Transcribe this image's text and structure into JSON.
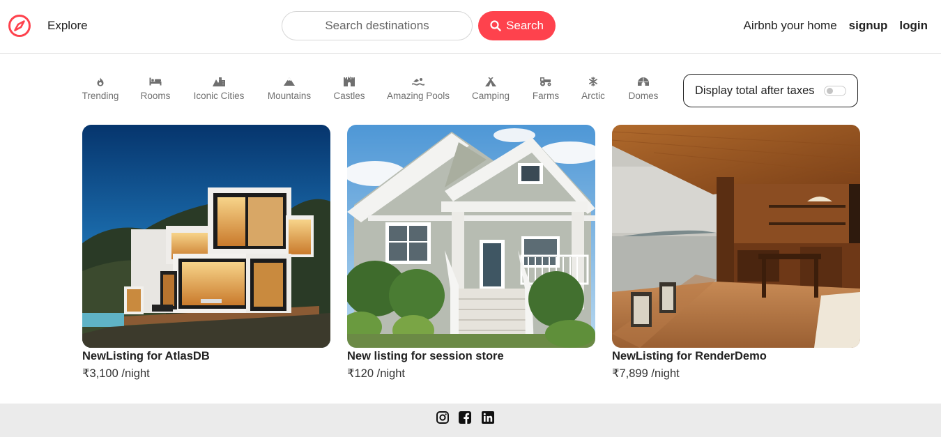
{
  "brand": {
    "icon": "compass-icon",
    "color": "#fe424d"
  },
  "nav": {
    "explore": "Explore",
    "search_placeholder": "Search destinations",
    "search_label": "Search",
    "host_link": "Airbnb your home",
    "signup": "signup",
    "login": "login"
  },
  "filters": [
    {
      "label": "Trending",
      "icon": "fire-icon"
    },
    {
      "label": "Rooms",
      "icon": "bed-icon"
    },
    {
      "label": "Iconic Cities",
      "icon": "mountain-city-icon"
    },
    {
      "label": "Mountains",
      "icon": "mountain-icon"
    },
    {
      "label": "Castles",
      "icon": "castle-icon"
    },
    {
      "label": "Amazing Pools",
      "icon": "person-swimming-icon"
    },
    {
      "label": "Camping",
      "icon": "campground-icon"
    },
    {
      "label": "Farms",
      "icon": "tractor-icon"
    },
    {
      "label": "Arctic",
      "icon": "snowflake-icon"
    },
    {
      "label": "Domes",
      "icon": "igloo-icon"
    }
  ],
  "tax_toggle": {
    "label": "Display total after taxes",
    "enabled": false
  },
  "listings": [
    {
      "title": "NewListing for AtlasDB",
      "price": "₹3,100 /night",
      "image": "modern-container-house-photo"
    },
    {
      "title": "New listing for session store",
      "price": "₹120 /night",
      "image": "craftsman-house-photo"
    },
    {
      "title": "NewListing for RenderDemo",
      "price": "₹7,899 /night",
      "image": "lake-view-deck-photo"
    }
  ],
  "footer": {
    "icons": [
      "instagram-icon",
      "facebook-icon",
      "linkedin-icon"
    ]
  }
}
